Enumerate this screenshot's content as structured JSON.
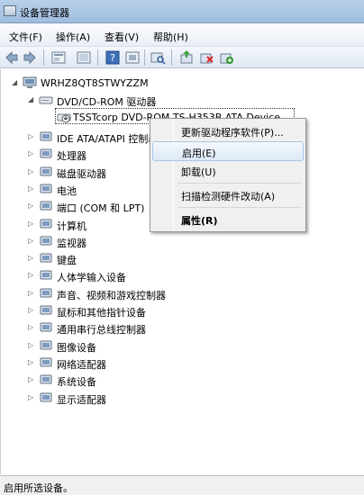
{
  "window": {
    "title": "设备管理器"
  },
  "menu": {
    "file": "文件(F)",
    "action": "操作(A)",
    "view": "查看(V)",
    "help": "帮助(H)"
  },
  "toolbar": {
    "icons": [
      "back-icon",
      "forward-icon",
      "properties-view-icon",
      "list-icon",
      "help-icon",
      "show-hidden-icon",
      "scan-icon",
      "update-driver-icon",
      "uninstall-icon",
      "enable-icon"
    ]
  },
  "tree": {
    "root": "WRHZ8QT8STWYZZM",
    "dvd_category": "DVD/CD-ROM 驱动器",
    "dvd_device": "TSSTcorp DVD-ROM TS-H353B ATA Device",
    "categories": [
      "IDE ATA/ATAPI 控制器",
      "处理器",
      "磁盘驱动器",
      "电池",
      "端口 (COM 和 LPT)",
      "计算机",
      "监视器",
      "键盘",
      "人体学输入设备",
      "声音、视频和游戏控制器",
      "鼠标和其他指针设备",
      "通用串行总线控制器",
      "图像设备",
      "网络适配器",
      "系统设备",
      "显示适配器"
    ]
  },
  "context_menu": {
    "update": "更新驱动程序软件(P)...",
    "enable": "启用(E)",
    "uninstall": "卸载(U)",
    "scan": "扫描检测硬件改动(A)",
    "properties": "属性(R)"
  },
  "status": {
    "text": "启用所选设备。"
  }
}
